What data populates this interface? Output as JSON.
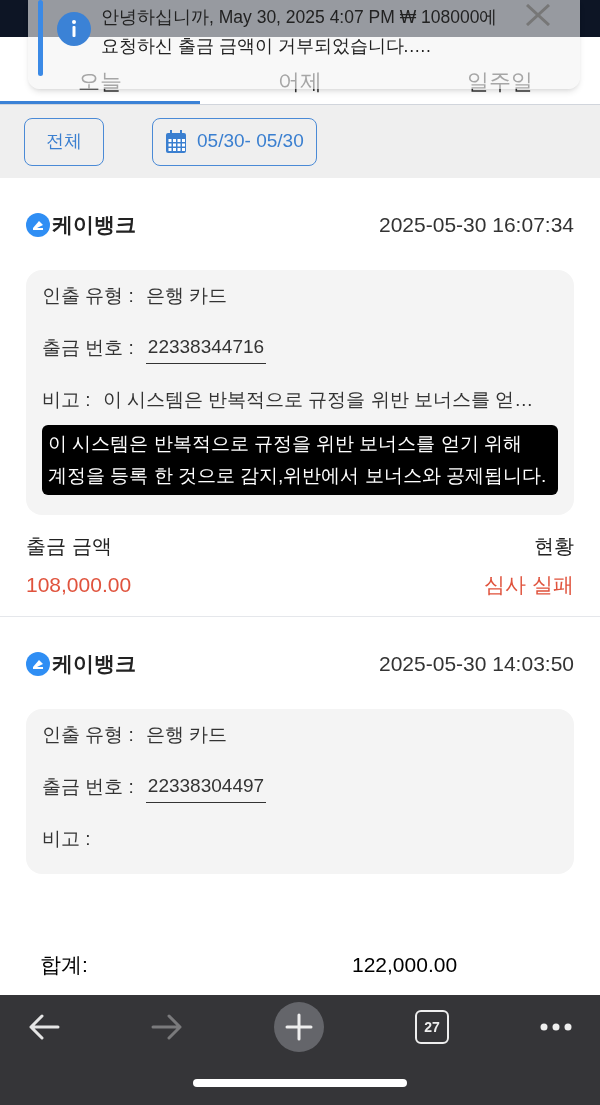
{
  "notification": {
    "message": "안녕하십니까, May 30, 2025 4:07 PM ₩ 108000에 요청하신 출금 금액이 거부되었습니다.…."
  },
  "tabs": [
    {
      "label": "오늘",
      "selected": true
    },
    {
      "label": "어제",
      "selected": false
    },
    {
      "label": "일주일",
      "selected": false
    }
  ],
  "filters": {
    "all_button": "전체",
    "date_range": "05/30- 05/30"
  },
  "records": [
    {
      "bank": "케이뱅크",
      "datetime": "2025-05-30 16:07:34",
      "fields": [
        {
          "label": "인출 유형 :",
          "value": "은행 카드",
          "underline": false
        },
        {
          "label": "출금 번호 :",
          "value": "22338344716",
          "underline": true
        },
        {
          "label": "비고 :",
          "value": "이 시스템은 반복적으로 규정을 위반 보너스를 얻…",
          "underline": false
        }
      ],
      "tooltip": "이 시스템은 반복적으로 규정을 위반 보너스를 얻기 위해 계정을 등록 한 것으로 감지,위반에서 보너스와 공제됩니다.",
      "amount_label": "출금 금액",
      "amount": "108,000.00",
      "status_label": "현황",
      "status": "심사 실패"
    },
    {
      "bank": "케이뱅크",
      "datetime": "2025-05-30 14:03:50",
      "fields": [
        {
          "label": "인출 유형 :",
          "value": "은행 카드",
          "underline": false
        },
        {
          "label": "출금 번호 :",
          "value": "22338304497",
          "underline": true
        },
        {
          "label": "비고 :",
          "underline": false
        }
      ]
    }
  ],
  "total": {
    "label": "합계:",
    "value": "122,000.00"
  },
  "browser_toolbar": {
    "tab_count": "27"
  }
}
